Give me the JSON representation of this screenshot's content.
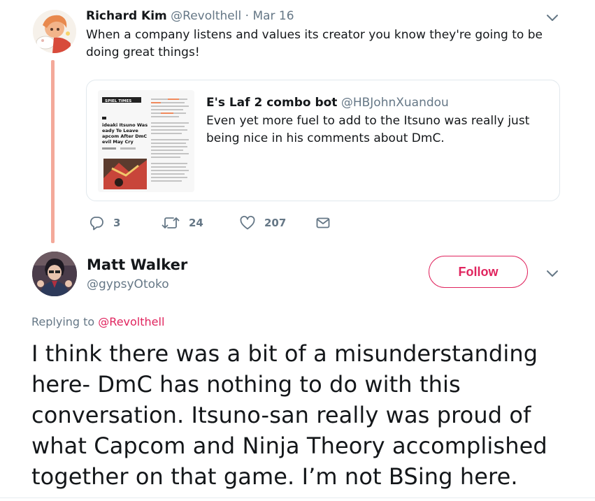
{
  "parent_tweet": {
    "author_name": "Richard Kim",
    "author_handle": "@Revolthell",
    "separator": "·",
    "date": "Mar 16",
    "text": "When a company listens and values its creator you know they're going to be doing great things!",
    "quoted_tweet": {
      "author_name": "E's Laf 2 combo bot",
      "author_handle": "@HBJohnXuandou",
      "text": "Even yet more fuel to add to the Itsuno was really just being nice in his comments about DmC.",
      "thumbnail": {
        "site_name": "SPIEL TIMES",
        "headline": "ideaki Itsuno Was eady To Leave apcom After DmC evil May Cry"
      }
    },
    "actions": {
      "reply_count": "3",
      "retweet_count": "24",
      "like_count": "207"
    }
  },
  "reply_tweet": {
    "author_name": "Matt Walker",
    "author_handle": "@gypsyOtoko",
    "follow_label": "Follow",
    "replying_prefix": "Replying to",
    "replying_to": "@Revolthell",
    "text": "I think there was a bit of a misunderstanding here- DmC has nothing to do with this conversation. Itsuno-san really was proud of what Capcom and Ninja Theory accomplished together on that game. I’m not BSing here."
  },
  "colors": {
    "accent": "#e0245e",
    "thread_line": "#f4a99a",
    "secondary_text": "#657786",
    "border": "#e1e8ed"
  },
  "icons": [
    "reply-icon",
    "retweet-icon",
    "like-icon",
    "dm-icon",
    "chevron-down-icon"
  ]
}
